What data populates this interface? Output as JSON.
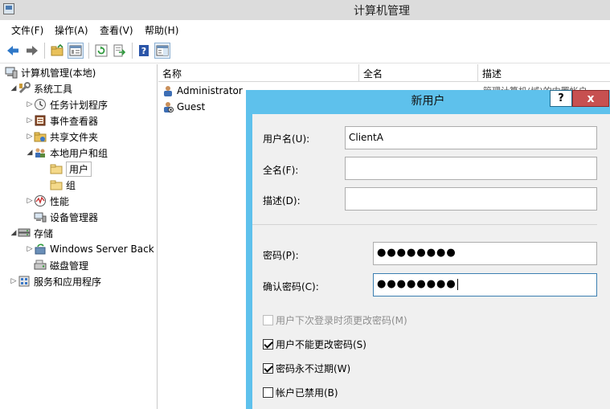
{
  "window": {
    "title": "计算机管理"
  },
  "menu": [
    "文件(F)",
    "操作(A)",
    "查看(V)",
    "帮助(H)"
  ],
  "toolbar_icons": [
    "back-arrow-icon",
    "forward-arrow-icon",
    "up-folder-icon",
    "show-hide-tree-icon",
    "refresh-icon",
    "export-list-icon",
    "help-icon",
    "action-pane-icon"
  ],
  "tree": {
    "root": "计算机管理(本地)",
    "system_tools": "系统工具",
    "task_scheduler": "任务计划程序",
    "event_viewer": "事件查看器",
    "shared_folders": "共享文件夹",
    "local_users_groups": "本地用户和组",
    "users": "用户",
    "groups": "组",
    "performance": "性能",
    "device_manager": "设备管理器",
    "storage": "存储",
    "windows_server_backup": "Windows Server Back",
    "disk_management": "磁盘管理",
    "services_apps": "服务和应用程序"
  },
  "list": {
    "headers": [
      "名称",
      "全名",
      "描述"
    ],
    "rows": [
      {
        "name": "Administrator",
        "desc_peek": "管理计算机(域)的内置帐户"
      },
      {
        "name": "Guest"
      }
    ]
  },
  "dialog": {
    "title": "新用户",
    "help_label": "?",
    "close_label": "x",
    "username_label": "用户名(U):",
    "username_value": "ClientA",
    "fullname_label": "全名(F):",
    "fullname_value": "",
    "description_label": "描述(D):",
    "description_value": "",
    "password_label": "密码(P):",
    "password_value": "●●●●●●●●",
    "confirm_label": "确认密码(C):",
    "confirm_value": "●●●●●●●●",
    "checkboxes": [
      {
        "label": "用户下次登录时须更改密码(M)",
        "checked": false,
        "disabled": true
      },
      {
        "label": "用户不能更改密码(S)",
        "checked": true,
        "disabled": false
      },
      {
        "label": "密码永不过期(W)",
        "checked": true,
        "disabled": false
      },
      {
        "label": "帐户已禁用(B)",
        "checked": false,
        "disabled": false
      }
    ]
  },
  "colors": {
    "dialog_frame": "#5ec1ec",
    "close_button": "#c75050",
    "dialog_body": "#f0f0f0"
  }
}
